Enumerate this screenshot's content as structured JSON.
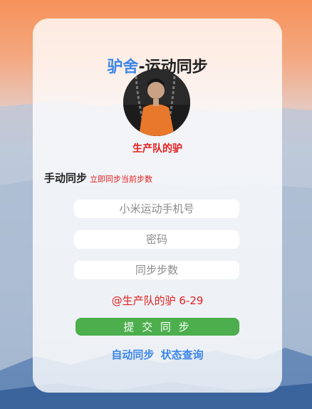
{
  "title": {
    "prefix": "驴舍",
    "suffix": "-运动同步"
  },
  "profile": {
    "name": "生产队的驴"
  },
  "manual": {
    "heading": "手动同步",
    "subtitle": "立即同步当前步数"
  },
  "form": {
    "phone_placeholder": "小米运动手机号",
    "password_placeholder": "密码",
    "steps_placeholder": "同步步数"
  },
  "credit": "@生产队的驴 6-29",
  "submit_label": "提 交 同 步",
  "links": {
    "auto": "自动同步",
    "status": "状态查询"
  },
  "colors": {
    "accent_blue": "#3c86e8",
    "accent_red": "#e41e1e",
    "submit_green": "#4cae4c"
  }
}
